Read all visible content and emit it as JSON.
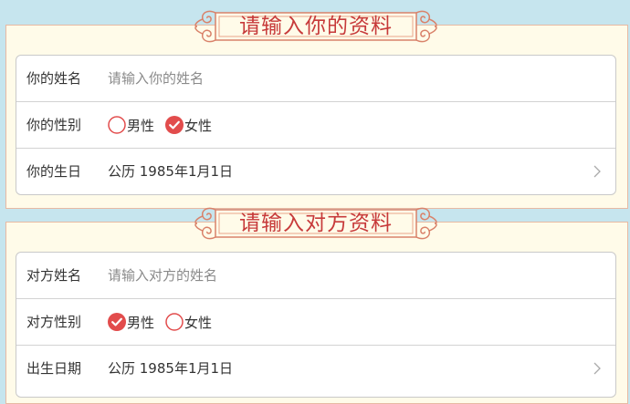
{
  "self_section": {
    "title": "请输入你的资料",
    "name": {
      "label": "你的姓名",
      "placeholder": "请输入你的姓名",
      "value": ""
    },
    "gender": {
      "label": "你的性别",
      "options": [
        {
          "label": "男性",
          "checked": false
        },
        {
          "label": "女性",
          "checked": true
        }
      ]
    },
    "birthday": {
      "label": "你的生日",
      "value": "公历 1985年1月1日"
    }
  },
  "partner_section": {
    "title": "请输入对方资料",
    "name": {
      "label": "对方姓名",
      "placeholder": "请输入对方的姓名",
      "value": ""
    },
    "gender": {
      "label": "对方性别",
      "options": [
        {
          "label": "男性",
          "checked": true
        },
        {
          "label": "女性",
          "checked": false
        }
      ]
    },
    "birthday": {
      "label": "出生日期",
      "value": "公历 1985年1月1日"
    }
  },
  "colors": {
    "accent_red": "#e24c4c",
    "title_red": "#c73a3a",
    "panel_bg": "#fffbe9",
    "page_bg": "#c6e5ee",
    "banner_stroke": "#d9826a"
  },
  "icons": {
    "radio_checked": "check-circle-icon",
    "radio_unchecked": "circle-outline-icon",
    "row_arrow": "chevron-right-icon",
    "banner_ornament": "scroll-ornament-icon"
  }
}
